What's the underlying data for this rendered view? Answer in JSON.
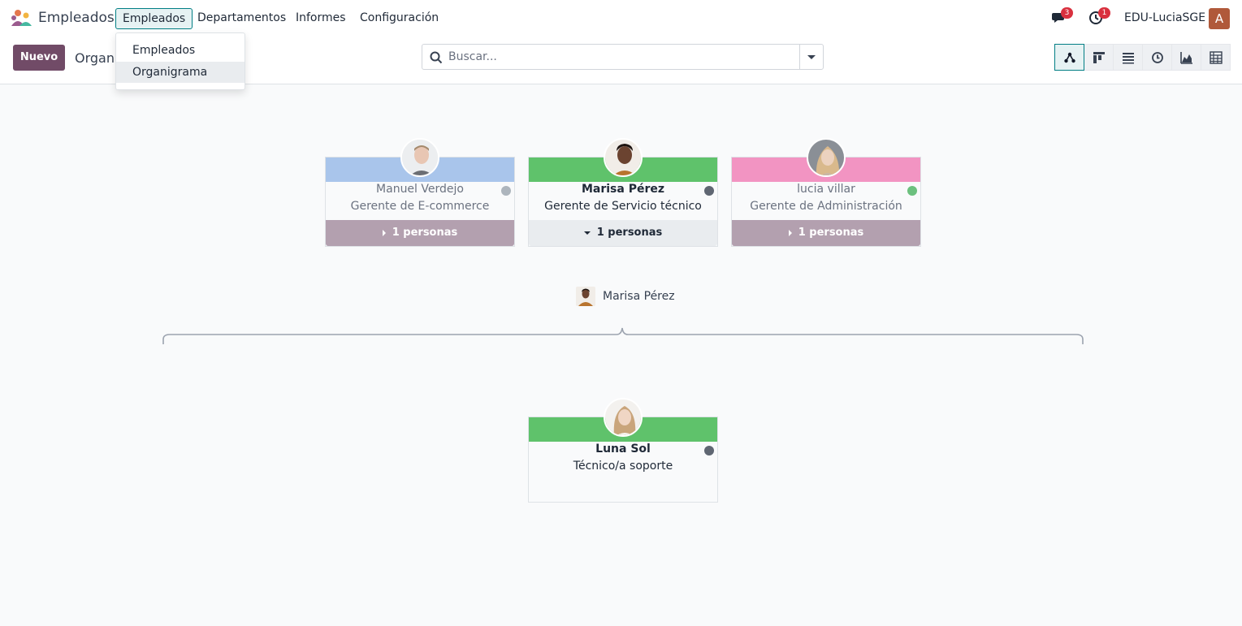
{
  "navbar": {
    "app_name": "Empleados",
    "menu": [
      "Empleados",
      "Departamentos",
      "Informes",
      "Configuración"
    ],
    "messages_count": "3",
    "activities_count": "1",
    "company": "EDU-LuciaSGE",
    "user_initial": "A"
  },
  "dropdown": {
    "items": [
      "Empleados",
      "Organigrama"
    ]
  },
  "control_panel": {
    "new_label": "Nuevo",
    "breadcrumb": "Organi",
    "search_placeholder": "Buscar..."
  },
  "views": [
    "hierarchy-icon",
    "kanban-icon",
    "list-icon",
    "activity-icon",
    "graph-icon",
    "pivot-icon"
  ],
  "top_cards": [
    {
      "name": "Manuel Verdejo",
      "job": "Gerente de E-commerce",
      "footer": "1 personas",
      "band_color": "#a9c5eb",
      "status_color": "#adb5bd"
    },
    {
      "name": "Marisa Pérez",
      "job": "Gerente de Servicio técnico",
      "footer": "1 personas",
      "band_color": "#5fc26b",
      "status_color": "#5f6672"
    },
    {
      "name": "lucia villar",
      "job": "Gerente de Administración",
      "footer": "1 personas",
      "band_color": "#f294c2",
      "status_color": "#6cc07e"
    }
  ],
  "manager_label": "Marisa Pérez",
  "child_card": {
    "name": "Luna Sol",
    "job": "Técnico/a soporte",
    "band_color": "#5fc26b",
    "status_color": "#5f6672"
  }
}
